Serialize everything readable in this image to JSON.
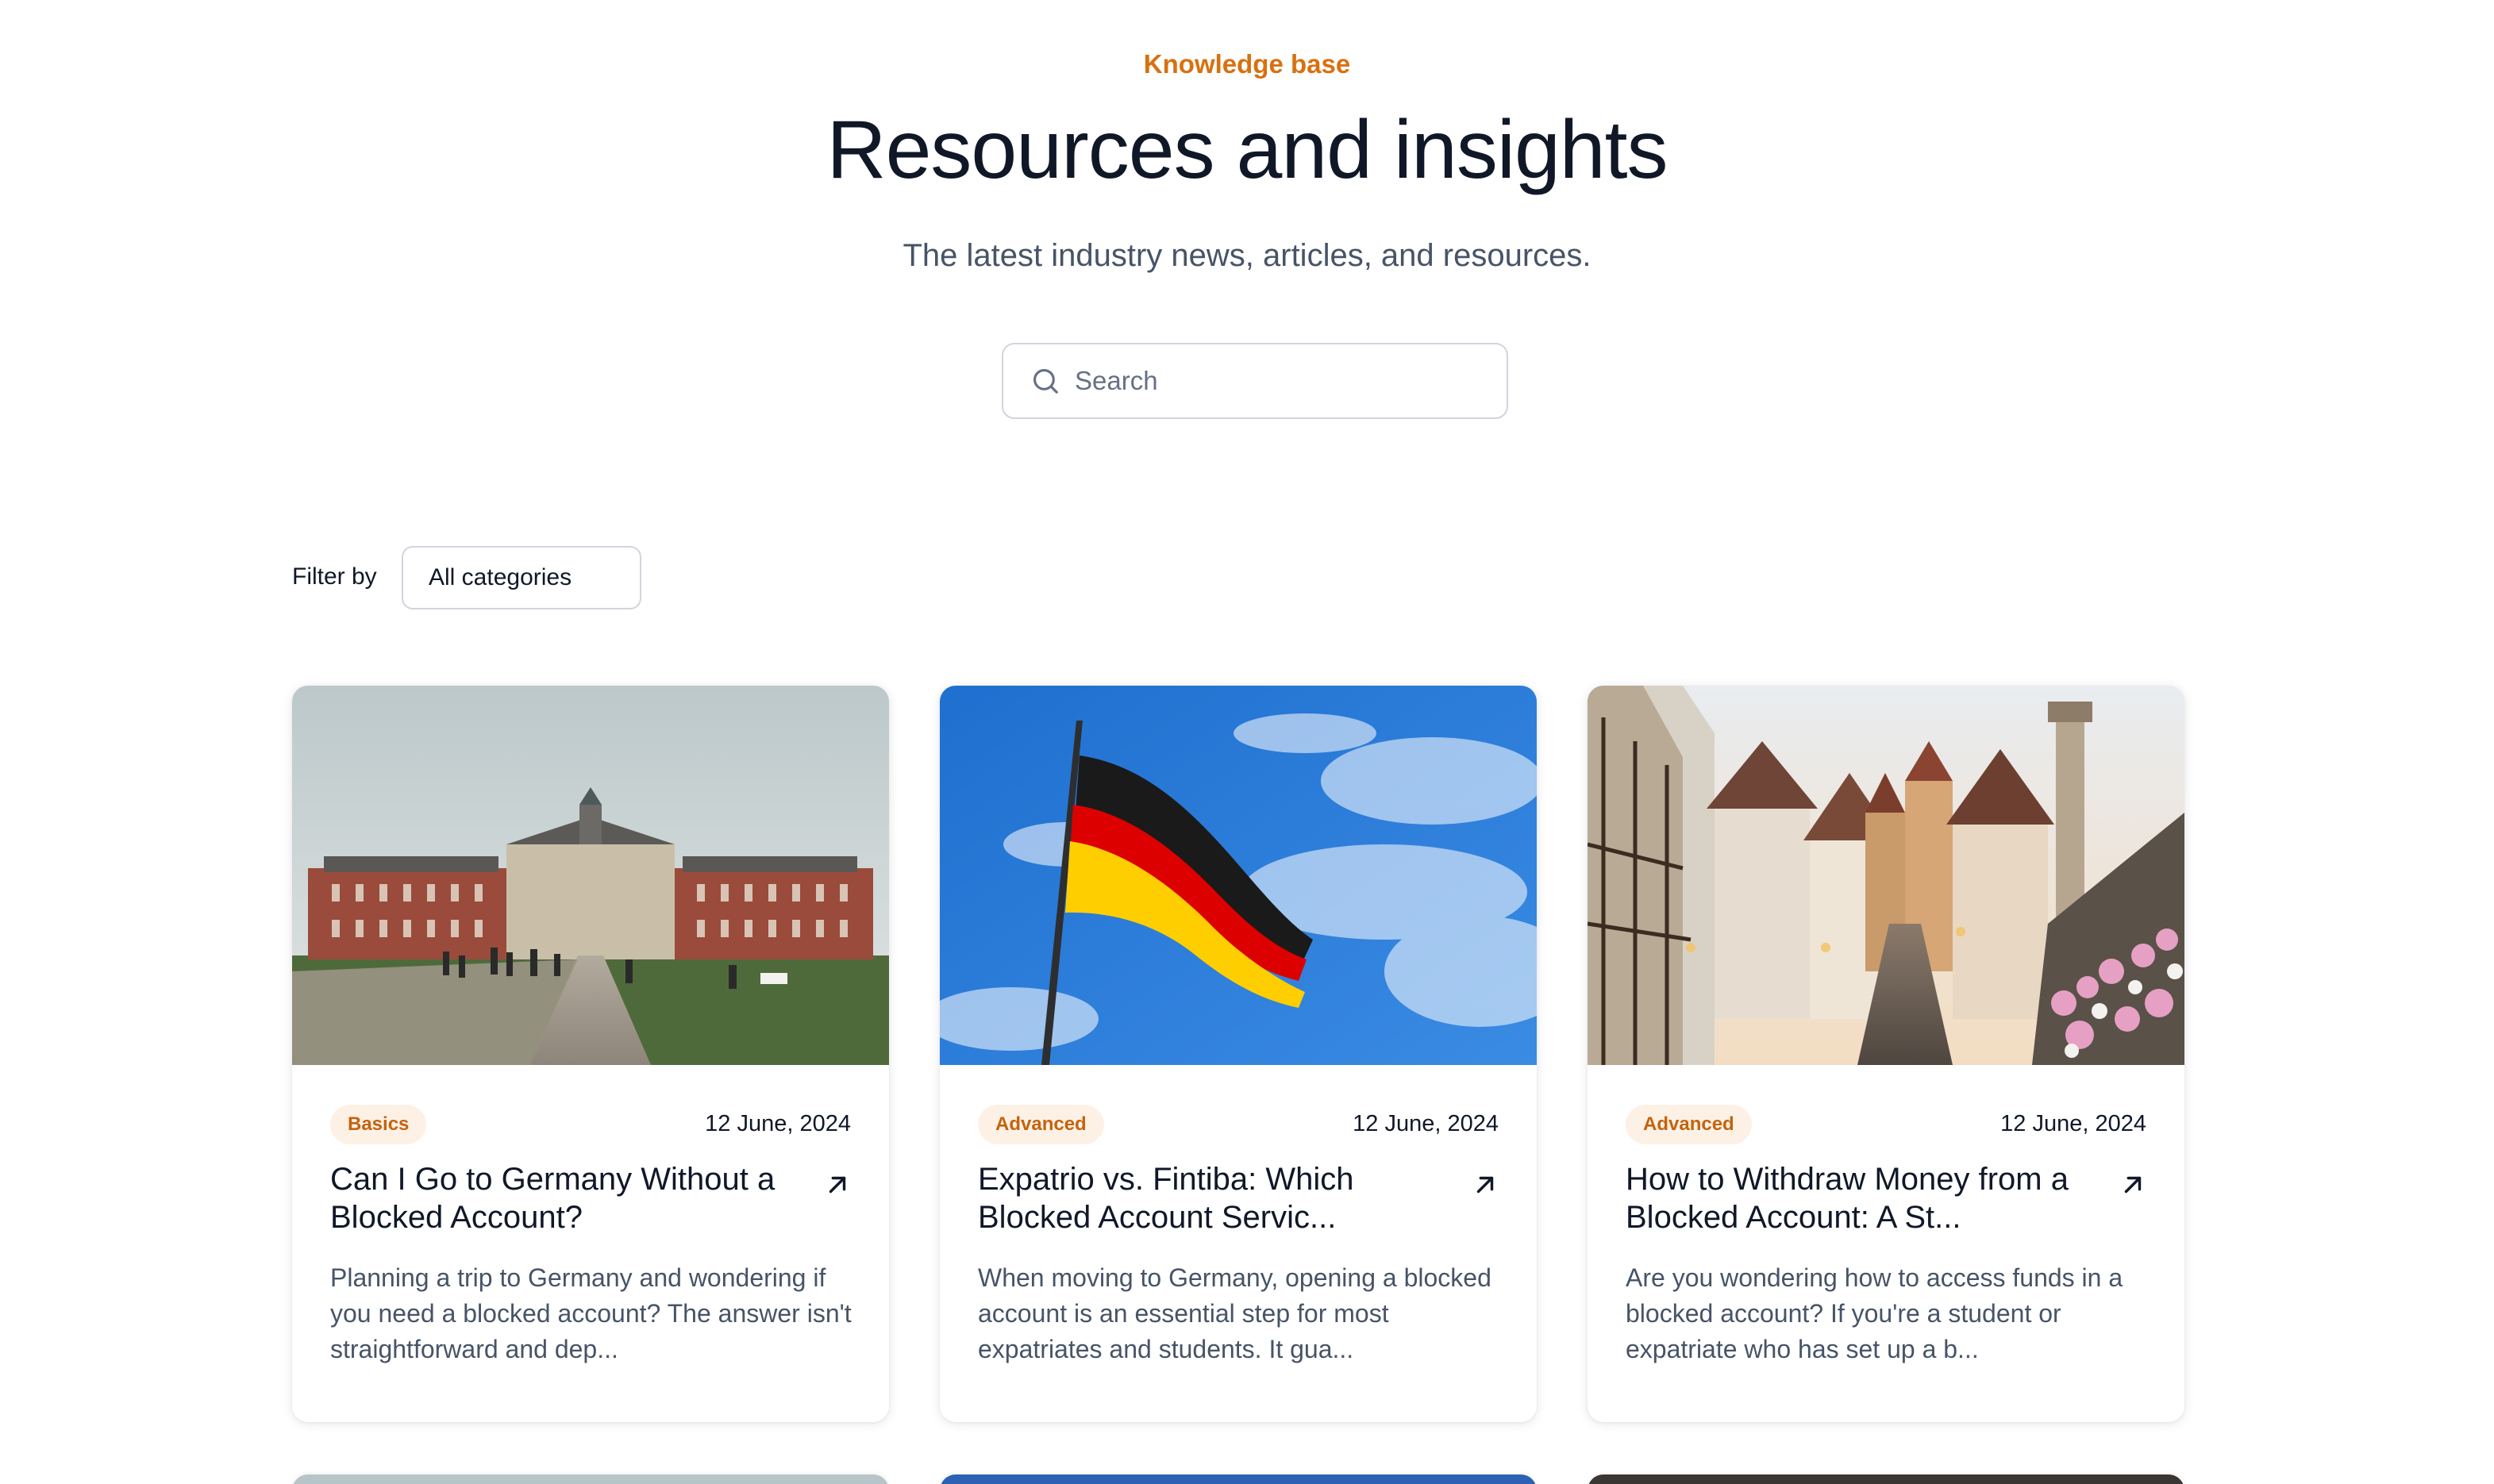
{
  "header": {
    "eyebrow": "Knowledge base",
    "title": "Resources and insights",
    "subtitle": "The latest industry news, articles, and resources."
  },
  "search": {
    "placeholder": "Search",
    "icon": "search-icon"
  },
  "filter": {
    "label": "Filter by",
    "selected": "All categories"
  },
  "colors": {
    "accent": "#d9700f",
    "badge_bg": "#fdf1e6",
    "text": "#101828",
    "muted": "#475467"
  },
  "posts": [
    {
      "category": "Basics",
      "date": "12 June, 2024",
      "title": "Can I Go to Germany Without a Blocked Account?",
      "excerpt": "Planning a trip to Germany and wondering if you need a blocked account? The answer isn't straightforward and dep...",
      "image": "palace-photo"
    },
    {
      "category": "Advanced",
      "date": "12 June, 2024",
      "title": "Expatrio vs. Fintiba: Which Blocked Account Servic...",
      "excerpt": "When moving to Germany, opening a blocked account is an essential step for most expatriates and students. It gua...",
      "image": "german-flag-photo"
    },
    {
      "category": "Advanced",
      "date": "12 June, 2024",
      "title": "How to Withdraw Money from a Blocked Account: A St...",
      "excerpt": "Are you wondering how to access funds in a blocked account? If you're a student or expatriate who has set up a b...",
      "image": "old-town-street-photo"
    }
  ]
}
